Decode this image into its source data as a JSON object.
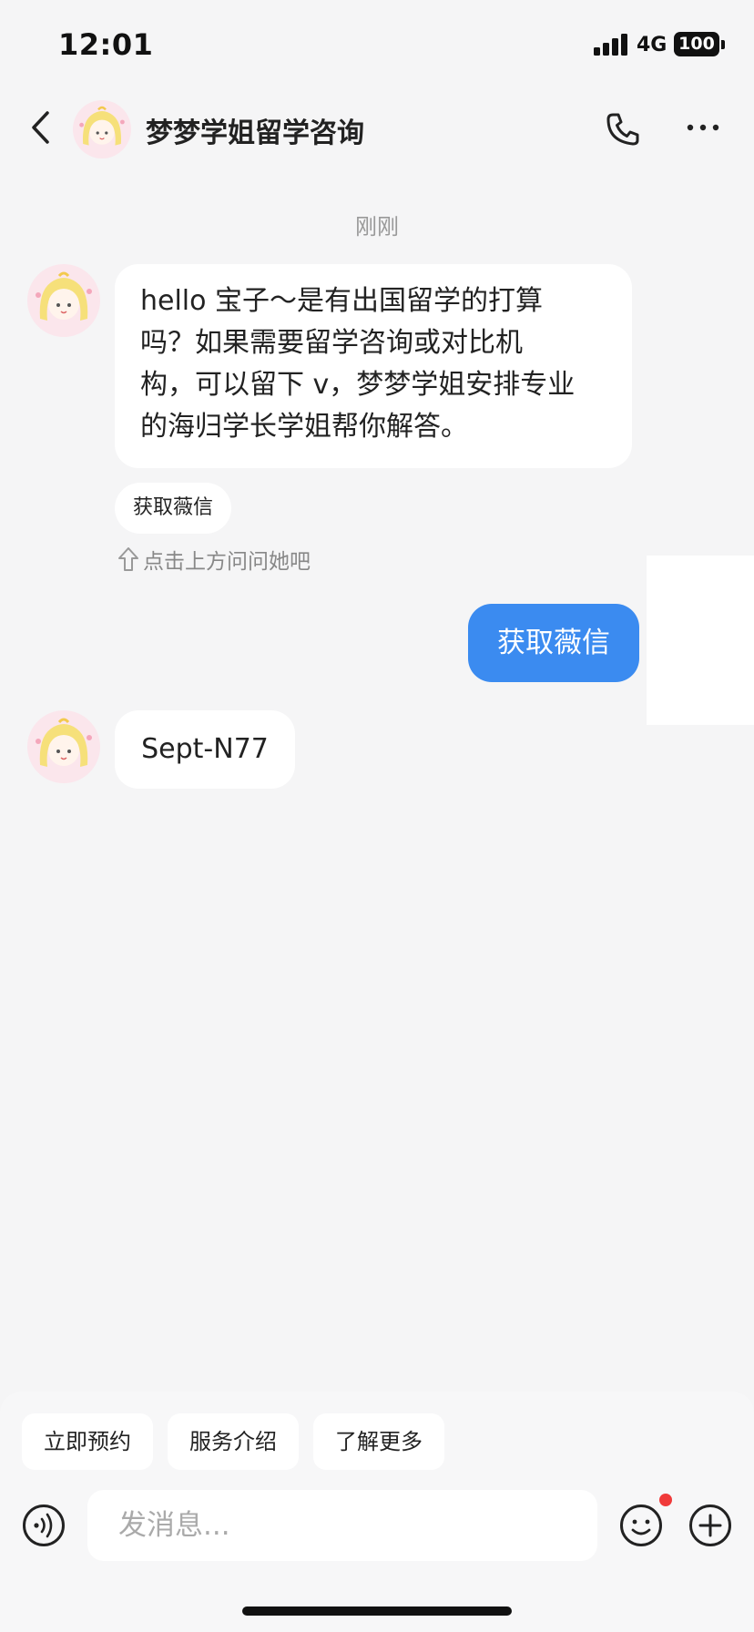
{
  "status_bar": {
    "time": "12:01",
    "network": "4G",
    "battery": "100"
  },
  "header": {
    "title": "梦梦学姐留学咨询"
  },
  "chat": {
    "timestamp": "刚刚",
    "message_1_lines": [
      "hello 宝子～是有出国留学的打算",
      "吗？如果需要留学咨询或对比机",
      "构，可以留下 v，梦梦学姐安排专业",
      "的海归学长学姐帮你解答。"
    ],
    "quick_reply": "获取薇信",
    "hint": "点击上方问问她吧",
    "sent_message": "获取薇信",
    "message_2": "Sept-N77"
  },
  "quick_buttons": [
    "立即预约",
    "服务介绍",
    "了解更多"
  ],
  "composer": {
    "placeholder": "发消息..."
  },
  "colors": {
    "accent": "#3b8bf0",
    "badge": "#f03a3a"
  },
  "icons": [
    "back-icon",
    "phone-icon",
    "more-icon",
    "voice-icon",
    "emoji-icon",
    "plus-icon",
    "arrow-up-icon",
    "signal-icon"
  ]
}
